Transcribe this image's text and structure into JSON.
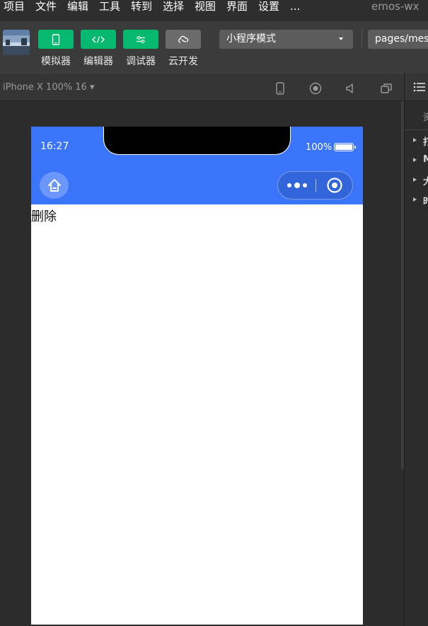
{
  "menu": {
    "items": [
      "项目",
      "文件",
      "编辑",
      "工具",
      "转到",
      "选择",
      "视图",
      "界面",
      "设置",
      "..."
    ],
    "app_title": "emos-wx"
  },
  "toolbar": {
    "buttons": [
      {
        "label": "模拟器",
        "icon": "phone-icon"
      },
      {
        "label": "编辑器",
        "icon": "code-icon"
      },
      {
        "label": "调试器",
        "icon": "debug-icon"
      },
      {
        "label": "云开发",
        "icon": "cloud-icon"
      }
    ],
    "mode_select": "小程序模式",
    "page_path": "pages/mess"
  },
  "simulator": {
    "device_label": "iPhone X 100% 16 ▾"
  },
  "right_panel": {
    "tab_label": "资",
    "rows": [
      "打",
      "M",
      "大",
      "时"
    ]
  },
  "phone": {
    "status_time": "16:27",
    "battery_text": "100%",
    "page_text": "删除"
  },
  "colors": {
    "accent_green": "#07b86f",
    "navbar_blue": "#3a74f8",
    "background_dark": "#2c2c2c"
  }
}
